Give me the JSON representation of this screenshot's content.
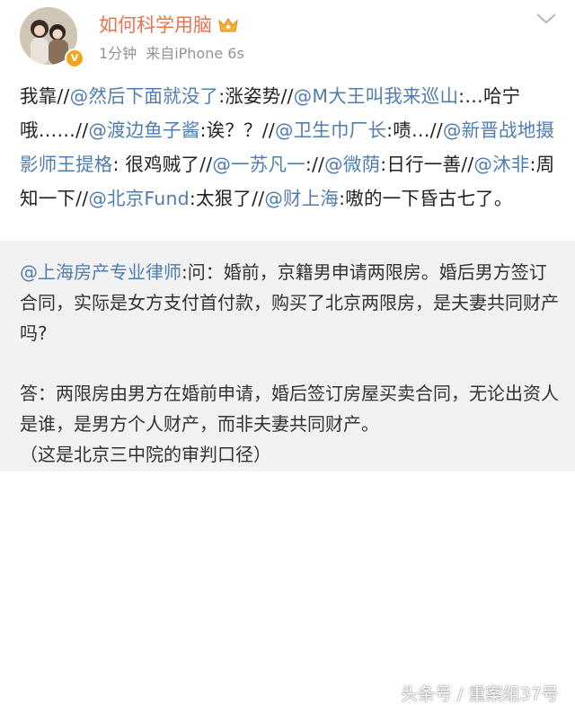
{
  "header": {
    "username": "如何科学用脑",
    "time": "1分钟",
    "source": "来自iPhone 6s",
    "icons": [
      "avatar",
      "verified-badge-icon",
      "crown-icon",
      "chevron-down-icon"
    ],
    "colors": {
      "username": "#eb7350",
      "mention": "#507daf",
      "meta": "#939393"
    }
  },
  "post": {
    "segments": [
      {
        "t": "我靠//",
        "at": false
      },
      {
        "t": "@然后下面就没了",
        "at": true
      },
      {
        "t": ":涨姿势//",
        "at": false
      },
      {
        "t": "@M大王叫我来巡山",
        "at": true
      },
      {
        "t": ":…哈宁哦……//",
        "at": false
      },
      {
        "t": "@渡边鱼子酱",
        "at": true
      },
      {
        "t": ":诶？？//",
        "at": false
      },
      {
        "t": "@卫生巾厂长",
        "at": true
      },
      {
        "t": ":啧…//",
        "at": false
      },
      {
        "t": "@新晋战地摄影师王提格",
        "at": true
      },
      {
        "t": ": 很鸡贼了//",
        "at": false
      },
      {
        "t": "@一苏凡一",
        "at": true
      },
      {
        "t": ":",
        "at": false
      },
      {
        "t": "//",
        "at": false
      },
      {
        "t": "@微荫",
        "at": true
      },
      {
        "t": ":日行一善//",
        "at": false
      },
      {
        "t": "@沐非",
        "at": true
      },
      {
        "t": ":周知一下//",
        "at": false
      },
      {
        "t": "@北京Fund",
        "at": true
      },
      {
        "t": ":太狠了//",
        "at": false
      },
      {
        "t": "@财上海",
        "at": true
      },
      {
        "t": ":嗷的一下昏古七了。",
        "at": false
      }
    ]
  },
  "quote": {
    "mention": "@上海房产专业律师",
    "question": ":问：婚前，京籍男申请两限房。婚后男方签订合同，实际是女方支付首付款，购买了北京两限房，是夫妻共同财产吗?",
    "answer": "答：两限房由男方在婚前申请，婚后签订房屋买卖合同，无论出资人是谁，是男方个人财产，而非夫妻共同财产。",
    "note": "（这是北京三中院的审判口径）"
  },
  "watermark": {
    "left": "头条号 / 重案组37号"
  }
}
